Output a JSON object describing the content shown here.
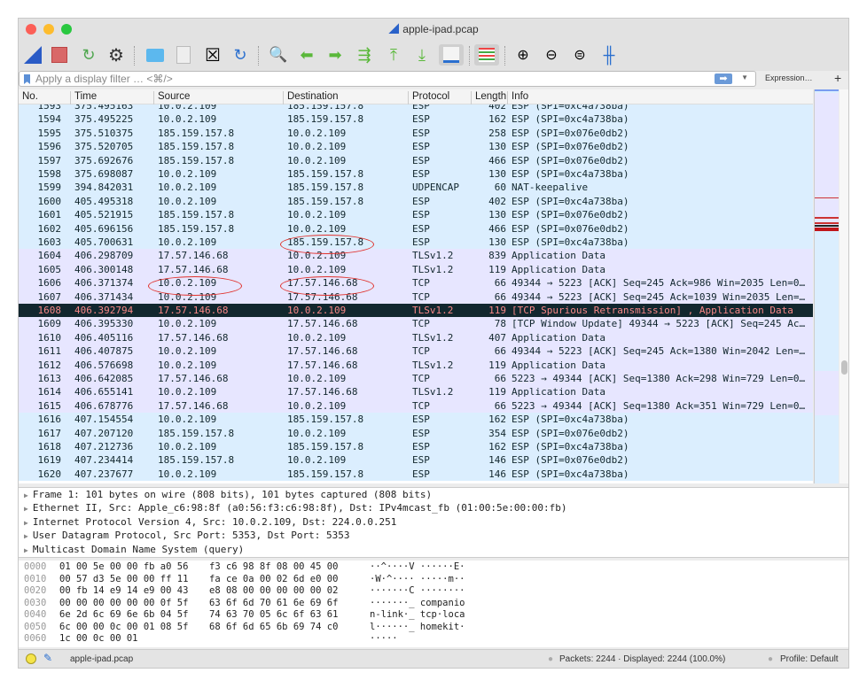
{
  "window": {
    "title": "apple-ipad.pcap"
  },
  "toolbar": {
    "icons": [
      "shark-fin-start-icon",
      "stop-icon",
      "restart-capture-icon",
      "capture-options-icon",
      "open-folder-icon",
      "save-file-icon",
      "close-file-icon",
      "reload-icon",
      "find-icon",
      "go-back-icon",
      "go-forward-icon",
      "go-to-packet-icon",
      "first-packet-icon",
      "last-packet-icon",
      "autoscroll-icon",
      "colorize-icon",
      "zoom-in-icon",
      "zoom-out-icon",
      "zoom-normal-icon",
      "resize-columns-icon"
    ]
  },
  "filter": {
    "placeholder": "Apply a display filter … <⌘/>",
    "expression_label": "Expression…",
    "plus_label": "+",
    "apply_label": "➡"
  },
  "packet_list": {
    "columns": [
      "No.",
      "Time",
      "Source",
      "Destination",
      "Protocol",
      "Length",
      "Info"
    ],
    "selected": "1608",
    "colors": {
      "esp": "#dbeefe",
      "tcp": "#e7e6ff",
      "selected_bg": "#12272e",
      "selected_fg": "#f78787"
    },
    "rows": [
      [
        "1593",
        "375.495163",
        "10.0.2.109",
        "185.159.157.8",
        "ESP",
        "402",
        "ESP (SPI=0xc4a738ba)"
      ],
      [
        "1594",
        "375.495225",
        "10.0.2.109",
        "185.159.157.8",
        "ESP",
        "162",
        "ESP (SPI=0xc4a738ba)"
      ],
      [
        "1595",
        "375.510375",
        "185.159.157.8",
        "10.0.2.109",
        "ESP",
        "258",
        "ESP (SPI=0x076e0db2)"
      ],
      [
        "1596",
        "375.520705",
        "185.159.157.8",
        "10.0.2.109",
        "ESP",
        "130",
        "ESP (SPI=0x076e0db2)"
      ],
      [
        "1597",
        "375.692676",
        "185.159.157.8",
        "10.0.2.109",
        "ESP",
        "466",
        "ESP (SPI=0x076e0db2)"
      ],
      [
        "1598",
        "375.698087",
        "10.0.2.109",
        "185.159.157.8",
        "ESP",
        "130",
        "ESP (SPI=0xc4a738ba)"
      ],
      [
        "1599",
        "394.842031",
        "10.0.2.109",
        "185.159.157.8",
        "UDPENCAP",
        "60",
        "NAT-keepalive"
      ],
      [
        "1600",
        "405.495318",
        "10.0.2.109",
        "185.159.157.8",
        "ESP",
        "402",
        "ESP (SPI=0xc4a738ba)"
      ],
      [
        "1601",
        "405.521915",
        "185.159.157.8",
        "10.0.2.109",
        "ESP",
        "130",
        "ESP (SPI=0x076e0db2)"
      ],
      [
        "1602",
        "405.696156",
        "185.159.157.8",
        "10.0.2.109",
        "ESP",
        "466",
        "ESP (SPI=0x076e0db2)"
      ],
      [
        "1603",
        "405.700631",
        "10.0.2.109",
        "185.159.157.8",
        "ESP",
        "130",
        "ESP (SPI=0xc4a738ba)"
      ],
      [
        "1604",
        "406.298709",
        "17.57.146.68",
        "10.0.2.109",
        "TLSv1.2",
        "839",
        "Application Data"
      ],
      [
        "1605",
        "406.300148",
        "17.57.146.68",
        "10.0.2.109",
        "TLSv1.2",
        "119",
        "Application Data"
      ],
      [
        "1606",
        "406.371374",
        "10.0.2.109",
        "17.57.146.68",
        "TCP",
        "66",
        "49344 → 5223 [ACK] Seq=245 Ack=986 Win=2035 Len=0…"
      ],
      [
        "1607",
        "406.371434",
        "10.0.2.109",
        "17.57.146.68",
        "TCP",
        "66",
        "49344 → 5223 [ACK] Seq=245 Ack=1039 Win=2035 Len=…"
      ],
      [
        "1608",
        "406.392794",
        "17.57.146.68",
        "10.0.2.109",
        "TLSv1.2",
        "119",
        "[TCP Spurious Retransmission] , Application Data"
      ],
      [
        "1609",
        "406.395330",
        "10.0.2.109",
        "17.57.146.68",
        "TCP",
        "78",
        "[TCP Window Update] 49344 → 5223 [ACK] Seq=245 Ac…"
      ],
      [
        "1610",
        "406.405116",
        "17.57.146.68",
        "10.0.2.109",
        "TLSv1.2",
        "407",
        "Application Data"
      ],
      [
        "1611",
        "406.407875",
        "10.0.2.109",
        "17.57.146.68",
        "TCP",
        "66",
        "49344 → 5223 [ACK] Seq=245 Ack=1380 Win=2042 Len=…"
      ],
      [
        "1612",
        "406.576698",
        "10.0.2.109",
        "17.57.146.68",
        "TLSv1.2",
        "119",
        "Application Data"
      ],
      [
        "1613",
        "406.642085",
        "17.57.146.68",
        "10.0.2.109",
        "TCP",
        "66",
        "5223 → 49344 [ACK] Seq=1380 Ack=298 Win=729 Len=0…"
      ],
      [
        "1614",
        "406.655141",
        "10.0.2.109",
        "17.57.146.68",
        "TLSv1.2",
        "119",
        "Application Data"
      ],
      [
        "1615",
        "406.678776",
        "17.57.146.68",
        "10.0.2.109",
        "TCP",
        "66",
        "5223 → 49344 [ACK] Seq=1380 Ack=351 Win=729 Len=0…"
      ],
      [
        "1616",
        "407.154554",
        "10.0.2.109",
        "185.159.157.8",
        "ESP",
        "162",
        "ESP (SPI=0xc4a738ba)"
      ],
      [
        "1617",
        "407.207120",
        "185.159.157.8",
        "10.0.2.109",
        "ESP",
        "354",
        "ESP (SPI=0x076e0db2)"
      ],
      [
        "1618",
        "407.212736",
        "10.0.2.109",
        "185.159.157.8",
        "ESP",
        "162",
        "ESP (SPI=0xc4a738ba)"
      ],
      [
        "1619",
        "407.234414",
        "185.159.157.8",
        "10.0.2.109",
        "ESP",
        "146",
        "ESP (SPI=0x076e0db2)"
      ],
      [
        "1620",
        "407.237677",
        "10.0.2.109",
        "185.159.157.8",
        "ESP",
        "146",
        "ESP (SPI=0xc4a738ba)"
      ]
    ]
  },
  "details": [
    "Frame 1: 101 bytes on wire (808 bits), 101 bytes captured (808 bits)",
    "Ethernet II, Src: Apple_c6:98:8f (a0:56:f3:c6:98:8f), Dst: IPv4mcast_fb (01:00:5e:00:00:fb)",
    "Internet Protocol Version 4, Src: 10.0.2.109, Dst: 224.0.0.251",
    "User Datagram Protocol, Src Port: 5353, Dst Port: 5353",
    "Multicast Domain Name System (query)"
  ],
  "hex": [
    [
      "0000",
      "01 00 5e 00 00 fb a0 56",
      "f3 c6 98 8f 08 00 45 00",
      "··^····V ······E·"
    ],
    [
      "0010",
      "00 57 d3 5e 00 00 ff 11",
      "fa ce 0a 00 02 6d e0 00",
      "·W·^···· ·····m··"
    ],
    [
      "0020",
      "00 fb 14 e9 14 e9 00 43",
      "e8 08 00 00 00 00 00 02",
      "·······C ········"
    ],
    [
      "0030",
      "00 00 00 00 00 00 0f 5f",
      "63 6f 6d 70 61 6e 69 6f",
      "·······_ companio"
    ],
    [
      "0040",
      "6e 2d 6c 69 6e 6b 04 5f",
      "74 63 70 05 6c 6f 63 61",
      "n-link·_ tcp·loca"
    ],
    [
      "0050",
      "6c 00 00 0c 00 01 08 5f",
      "68 6f 6d 65 6b 69 74 c0",
      "l······_ homekit·"
    ],
    [
      "0060",
      "1c 00 0c 00 01",
      "",
      "·····"
    ]
  ],
  "status": {
    "file": "apple-ipad.pcap",
    "packets": "Packets: 2244 · Displayed: 2244 (100.0%)",
    "profile": "Profile: Default"
  }
}
